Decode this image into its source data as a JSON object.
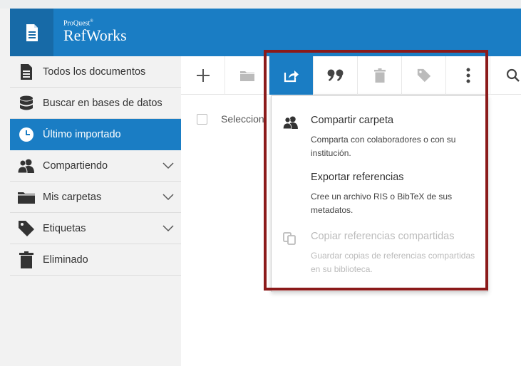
{
  "header": {
    "brand_small": "ProQuest",
    "brand_small_mark": "®",
    "brand_name": "RefWorks",
    "colors": {
      "header_bg": "#1a7dc4",
      "logo_bg": "#176aa7",
      "highlight_border": "#8b1a1a"
    }
  },
  "sidebar": {
    "items": [
      {
        "label": "Todos los documentos",
        "icon": "document-icon"
      },
      {
        "label": "Buscar en bases de datos",
        "icon": "database-icon"
      },
      {
        "label": "Último importado",
        "icon": "clock-icon",
        "active": true
      },
      {
        "label": "Compartiendo",
        "icon": "users-icon",
        "expandable": true
      },
      {
        "label": "Mis carpetas",
        "icon": "folder-icon",
        "expandable": true
      },
      {
        "label": "Etiquetas",
        "icon": "tag-icon",
        "expandable": true
      },
      {
        "label": "Eliminado",
        "icon": "trash-icon"
      }
    ]
  },
  "toolbar": {
    "buttons": [
      {
        "icon": "plus-icon"
      },
      {
        "icon": "folder-icon"
      },
      {
        "icon": "share-icon",
        "active": true
      },
      {
        "icon": "quote-icon"
      },
      {
        "icon": "trash-icon"
      },
      {
        "icon": "tag-icon"
      },
      {
        "icon": "more-vertical-icon"
      },
      {
        "icon": "search-icon"
      }
    ]
  },
  "main": {
    "select_label": "Seleccion"
  },
  "share_menu": {
    "items": [
      {
        "title": "Compartir carpeta",
        "description": "Comparta con colaboradores o con su institución.",
        "icon": "users-icon",
        "disabled": false
      },
      {
        "title": "Exportar referencias",
        "description": "Cree un archivo RIS o BibTeX de sus metadatos.",
        "icon": "",
        "disabled": false
      },
      {
        "title": "Copiar referencias compartidas",
        "description": "Guardar copias de referencias compartidas en su biblioteca.",
        "icon": "copy-icon",
        "disabled": true
      }
    ]
  }
}
